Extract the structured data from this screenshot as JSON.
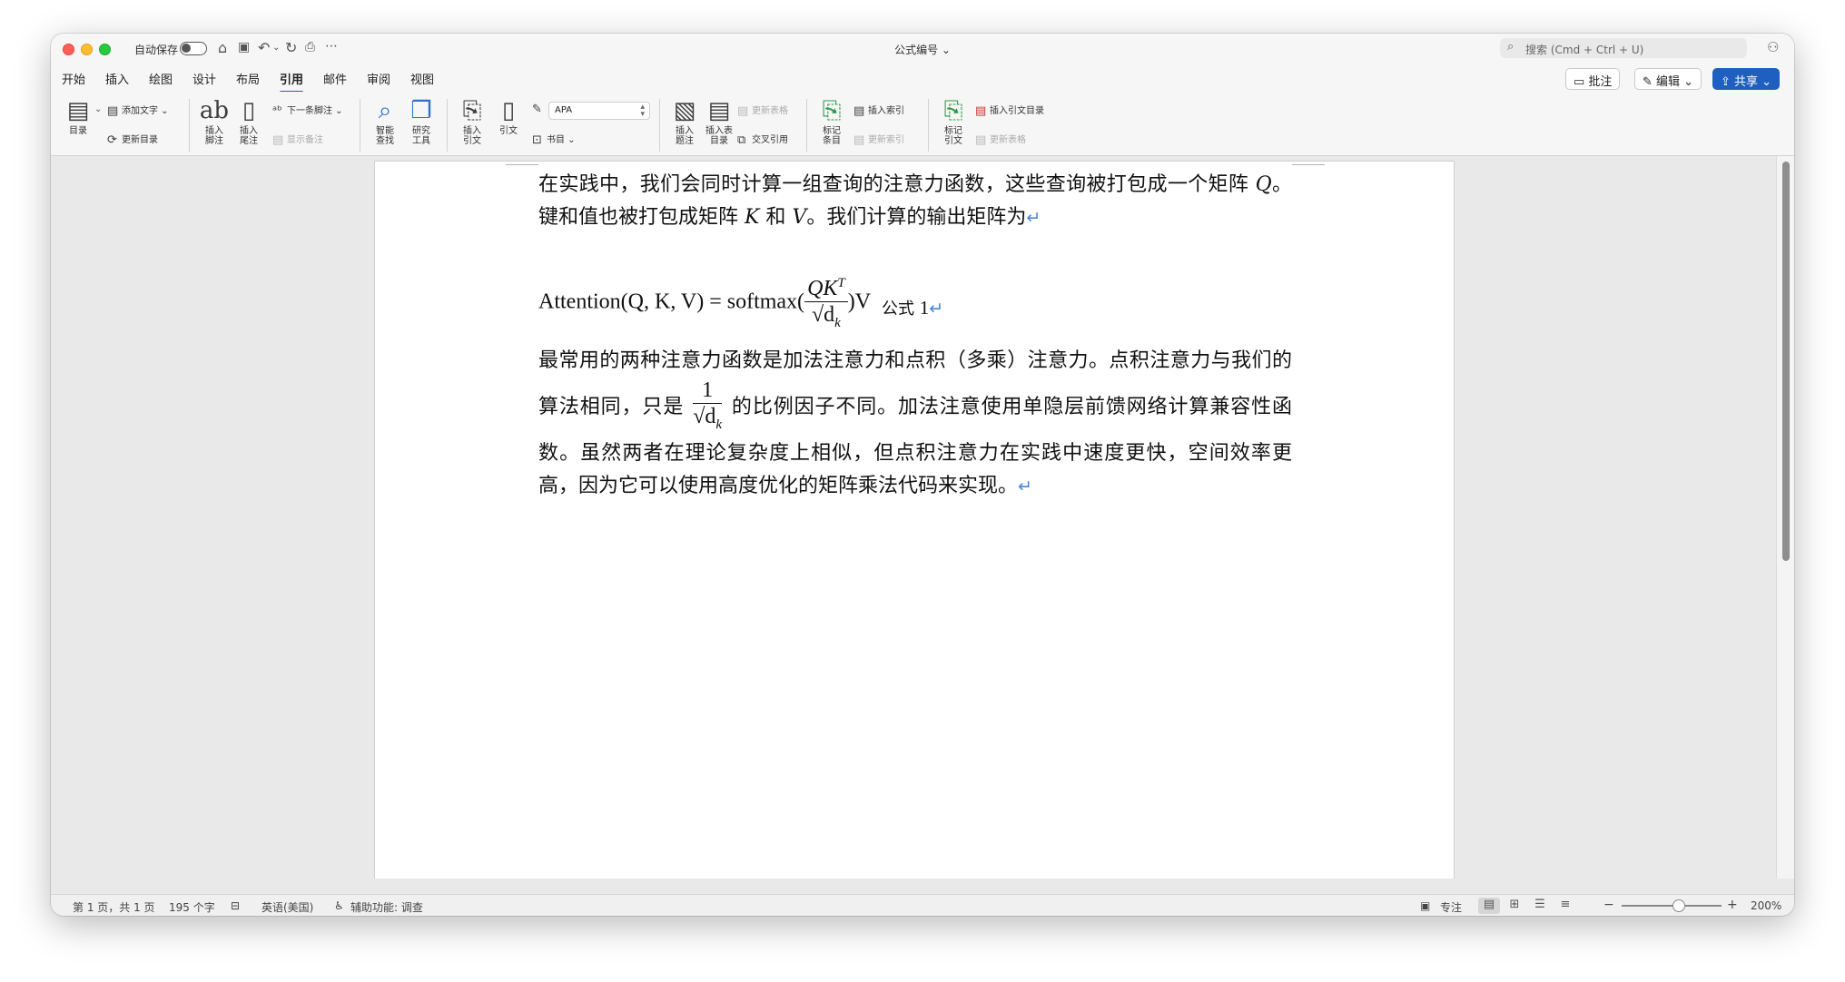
{
  "window": {
    "autosave_label": "自动保存",
    "doc_title": "公式编号 ⌄",
    "search_placeholder": "搜索 (Cmd + Ctrl + U)"
  },
  "tabs": [
    "开始",
    "插入",
    "绘图",
    "设计",
    "布局",
    "引用",
    "邮件",
    "审阅",
    "视图"
  ],
  "active_tab": "引用",
  "top_buttons": {
    "comment": "批注",
    "edit": "编辑 ⌄",
    "share": "共享 ⌄"
  },
  "ribbon": {
    "toc": "目录",
    "add_text": "添加文字 ⌄",
    "update_toc": "更新目录",
    "insert_footnote": "插入\n脚注",
    "insert_endnote": "插入\n尾注",
    "next_footnote": "下一条脚注 ⌄",
    "show_notes": "显示备注",
    "smart_lookup": "智能\n查找",
    "researcher": "研究\n工具",
    "insert_citation": "插入\n引文",
    "citation": "引文",
    "style_value": "APA",
    "bibliography": "书目 ⌄",
    "insert_caption": "插入\n题注",
    "insert_table_of_figures": "插入表\n目录",
    "update_table": "更新表格",
    "cross_reference": "交叉引用",
    "mark_entry": "标记\n条目",
    "insert_index": "插入索引",
    "update_index": "更新索引",
    "mark_citation": "标记\n引文",
    "insert_table_of_authorities": "插入引文目录",
    "update_table_2": "更新表格"
  },
  "document": {
    "para1": "在实践中，我们会同时计算一组查询的注意力函数，这些查询被打包成一个矩阵 ",
    "para1_q": "Q",
    "para1_b": "。键和值也被打包成矩阵 ",
    "para1_k": "K",
    "para1_c": " 和 ",
    "para1_v": "V",
    "para1_d": "。我们计算的输出矩阵为",
    "eq_lhs": "Attention(Q, K, V) = softmax(",
    "eq_num": "QK",
    "eq_sup": "T",
    "eq_den": "√d",
    "eq_sub": "k",
    "eq_rhs": ")V",
    "eq_label": "公式 ",
    "eq_number": "1",
    "para2a": "最常用的两种注意力函数是加法注意力和点积（多乘）注意力。点积注意力与我们的算法相同，只是",
    "frac_num": "1",
    "frac_den": "√d",
    "frac_sub": "k",
    "para2b": "的比例因子不同。加法注意使用单隐层前馈网络计算兼容性函数。虽然两者在理论复杂度上相似，但点积注意力在实践中速度更快，空间效率更高，因为它可以使用高度优化的矩阵乘法代码来实现。",
    "para_mark": "↵"
  },
  "status": {
    "page": "第 1 页，共 1 页",
    "words": "195 个字",
    "language": "英语(美国)",
    "accessibility": "辅助功能: 调查",
    "focus": "专注",
    "zoom": "200%"
  }
}
